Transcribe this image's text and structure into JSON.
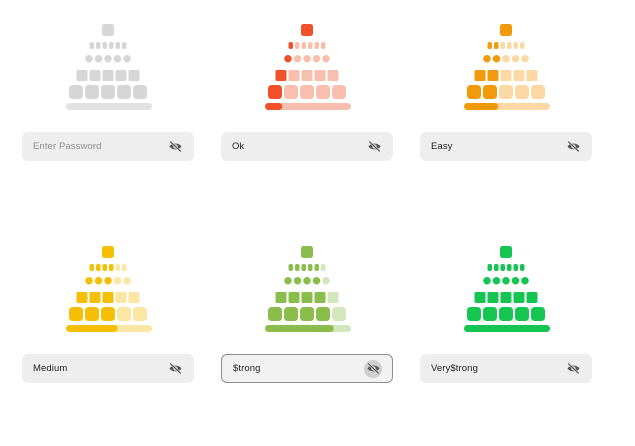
{
  "cards": [
    {
      "input": {
        "value": "",
        "placeholder": "Enter Password"
      },
      "strength_level": 0,
      "meter_fill": 0.0,
      "active_color": "#d6d6d6",
      "pale_color": "#e4e4e4",
      "icon": "eye-off-icon"
    },
    {
      "input": {
        "value": "Ok",
        "placeholder": "Enter Password"
      },
      "strength_level": 1,
      "meter_fill": 0.2,
      "active_color": "#f0502a",
      "pale_color": "#f9bfae",
      "icon": "eye-off-icon"
    },
    {
      "input": {
        "value": "Easy",
        "placeholder": "Enter Password"
      },
      "strength_level": 2,
      "meter_fill": 0.4,
      "active_color": "#f29a0c",
      "pale_color": "#fbd8a4",
      "icon": "eye-off-icon"
    },
    {
      "input": {
        "value": "Medium",
        "placeholder": "Enter Password"
      },
      "strength_level": 3,
      "meter_fill": 0.6,
      "active_color": "#f5bf06",
      "pale_color": "#fbe6a3",
      "icon": "eye-off-icon"
    },
    {
      "input": {
        "value": "$trong",
        "placeholder": "Enter Password"
      },
      "strength_level": 4,
      "meter_fill": 0.8,
      "active_color": "#8bbd4d",
      "pale_color": "#d3e7bd",
      "focused": true,
      "icon": "eye-off-icon"
    },
    {
      "input": {
        "value": "Very$trong",
        "placeholder": "Enter Password"
      },
      "strength_level": 5,
      "meter_fill": 1.0,
      "active_color": "#14c551",
      "pale_color": "#a9ebc0",
      "icon": "eye-off-icon"
    }
  ]
}
